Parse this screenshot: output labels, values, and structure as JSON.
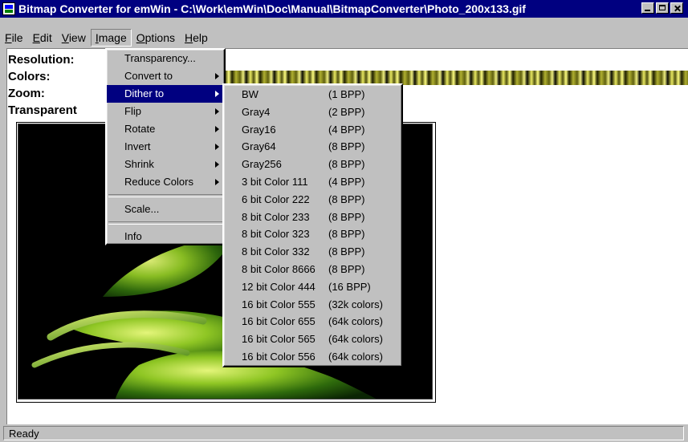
{
  "window": {
    "title": "Bitmap Converter for emWin - C:\\Work\\emWin\\Doc\\Manual\\BitmapConverter\\Photo_200x133.gif"
  },
  "menubar": {
    "items": [
      "File",
      "Edit",
      "View",
      "Image",
      "Options",
      "Help"
    ],
    "active": "Image"
  },
  "info": {
    "resolution_label": "Resolution:",
    "colors_label": "Colors:",
    "zoom_label": "Zoom:",
    "transparent_label": "Transparent"
  },
  "image_menu": {
    "items": [
      "Transparency...",
      "Convert to",
      "Dither to",
      "Flip",
      "Rotate",
      "Invert",
      "Shrink",
      "Reduce Colors",
      "Scale...",
      "Info"
    ],
    "highlighted": "Dither to"
  },
  "dither_submenu": {
    "items": [
      {
        "name": "BW",
        "format": "(1 BPP)"
      },
      {
        "name": "Gray4",
        "format": "(2 BPP)"
      },
      {
        "name": "Gray16",
        "format": "(4 BPP)"
      },
      {
        "name": "Gray64",
        "format": "(8 BPP)"
      },
      {
        "name": "Gray256",
        "format": "(8 BPP)"
      },
      {
        "name": "3 bit Color 111",
        "format": "(4 BPP)"
      },
      {
        "name": "6 bit Color 222",
        "format": "(8 BPP)"
      },
      {
        "name": "8 bit Color 233",
        "format": "(8 BPP)"
      },
      {
        "name": "8 bit Color 323",
        "format": "(8 BPP)"
      },
      {
        "name": "8 bit Color 332",
        "format": "(8 BPP)"
      },
      {
        "name": "8 bit Color 8666",
        "format": "(8 BPP)"
      },
      {
        "name": "12 bit Color 444",
        "format": "(16 BPP)"
      },
      {
        "name": "16 bit Color 555",
        "format": "(32k colors)"
      },
      {
        "name": "16 bit Color 655",
        "format": "(64k colors)"
      },
      {
        "name": "16 bit Color 565",
        "format": "(64k colors)"
      },
      {
        "name": "16 bit Color 556",
        "format": "(64k colors)"
      }
    ]
  },
  "statusbar": {
    "text": "Ready"
  },
  "icons": [
    "app-icon",
    "minimize-icon",
    "maximize-icon",
    "close-icon",
    "submenu-arrow-icon"
  ]
}
